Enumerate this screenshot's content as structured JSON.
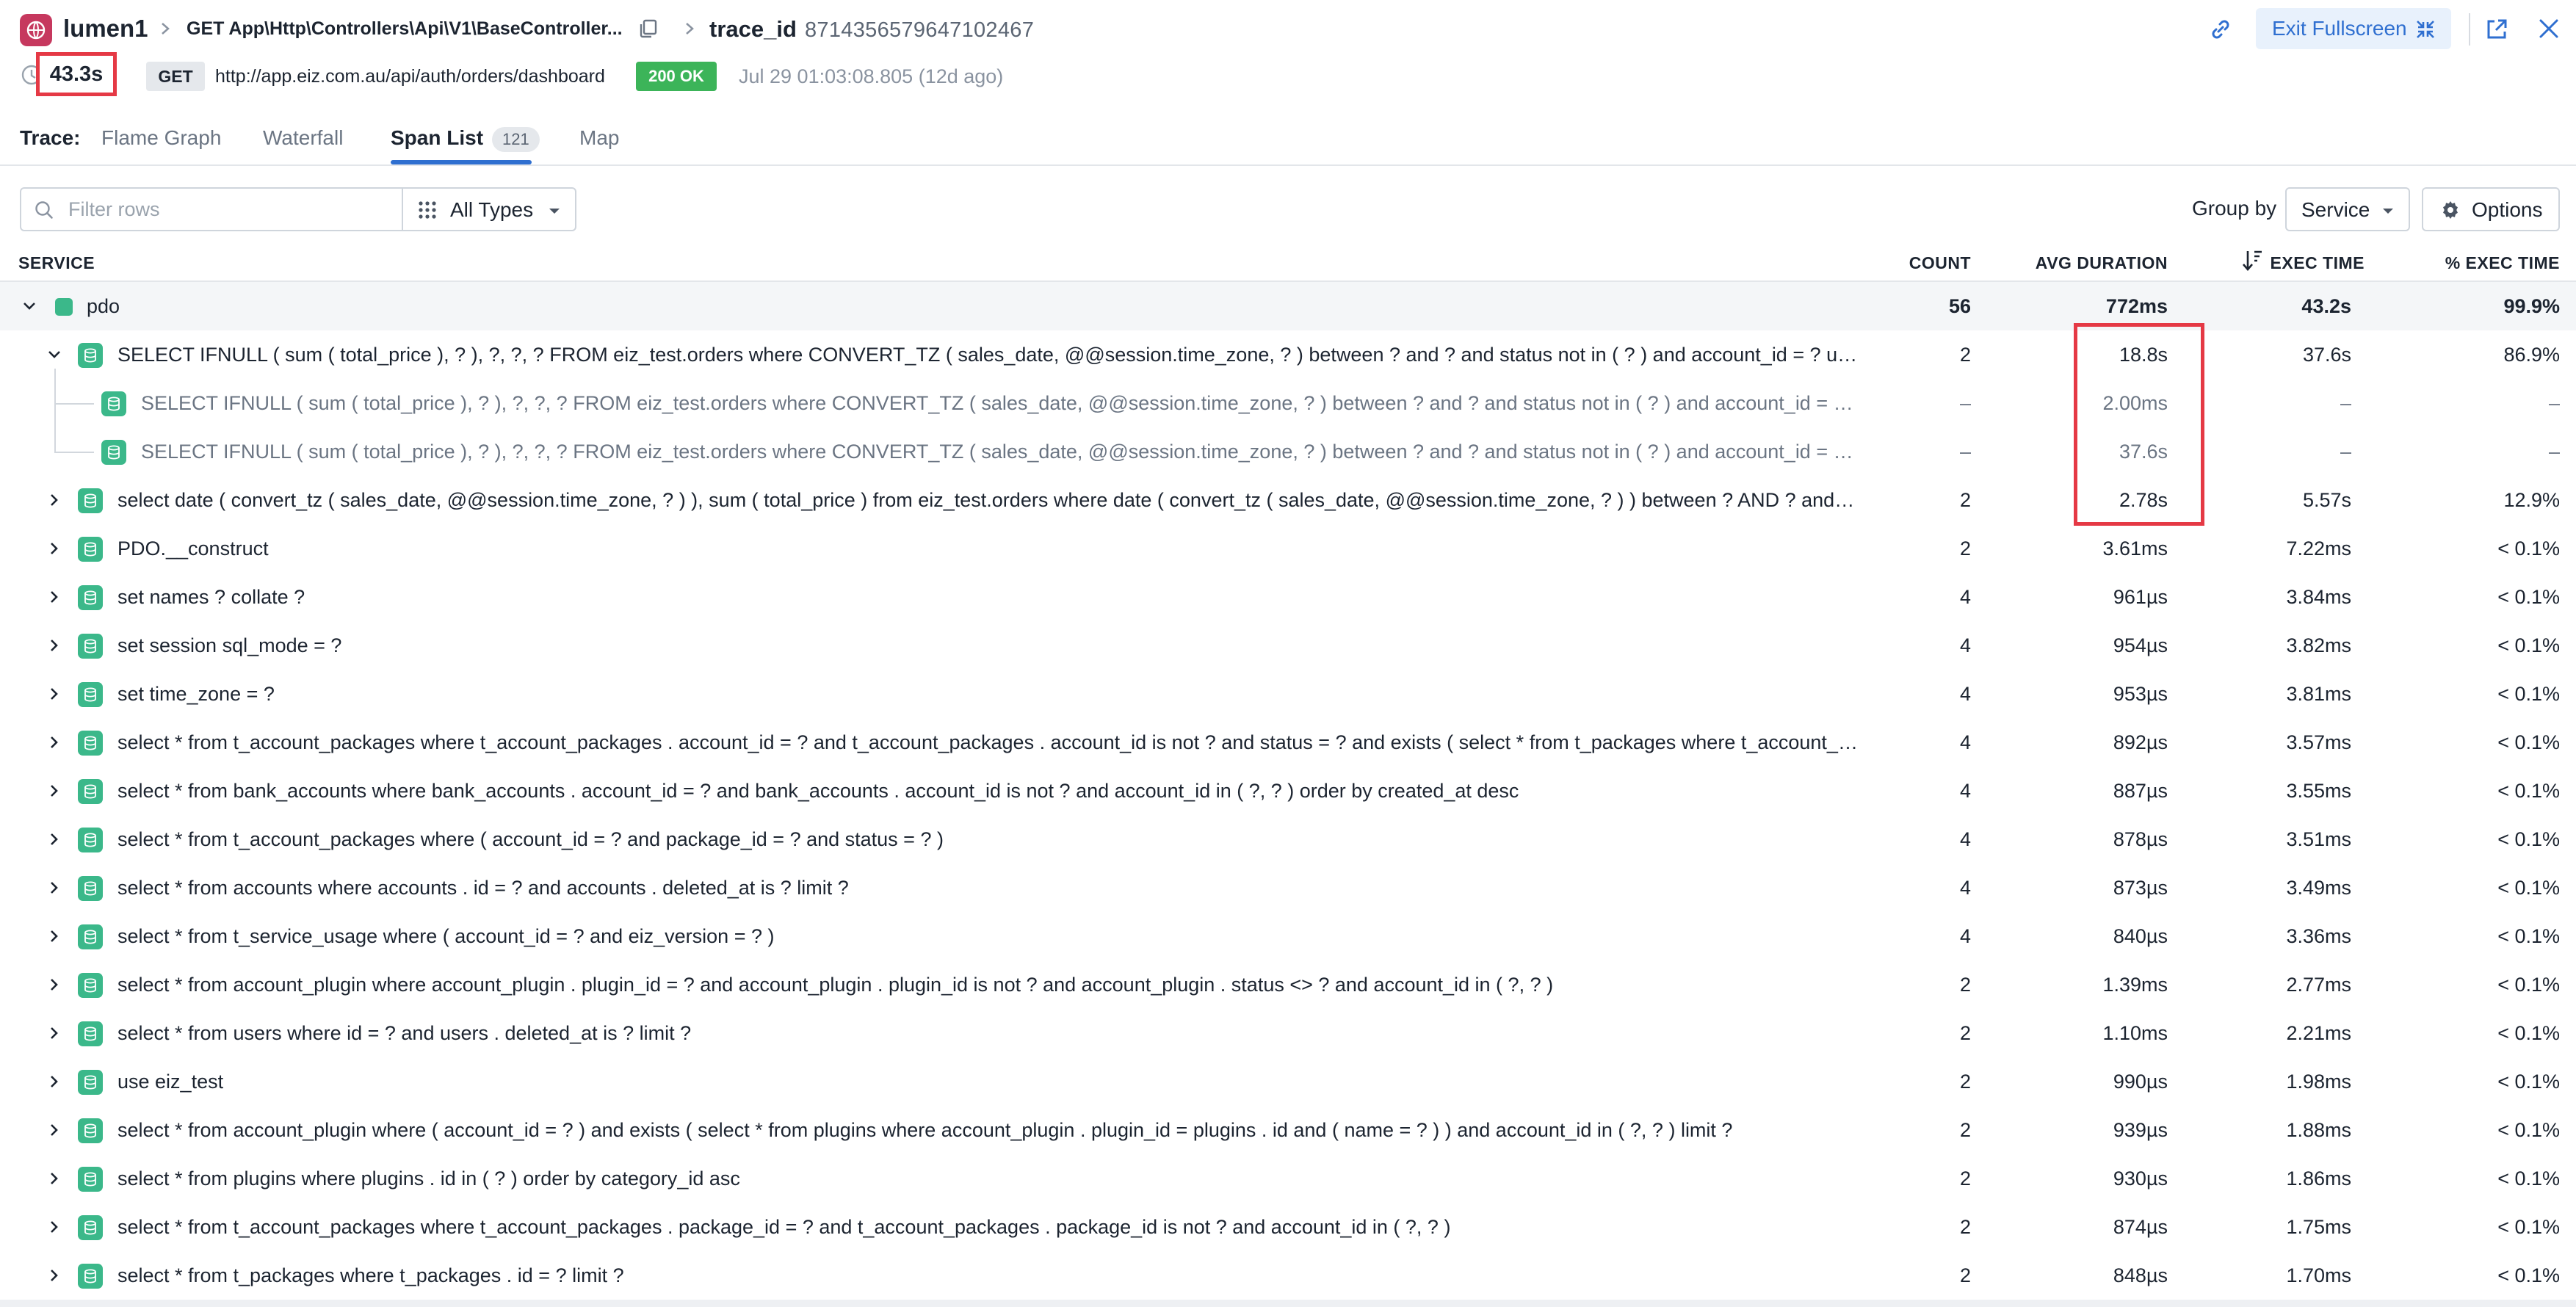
{
  "header": {
    "service": "lumen1",
    "resource": "GET App\\Http\\Controllers\\Api\\V1\\BaseController...",
    "trace_label": "trace_id",
    "trace_id": "8714356579647102467",
    "exit_fullscreen_label": "Exit Fullscreen"
  },
  "request": {
    "duration": "43.3s",
    "method": "GET",
    "url": "http://app.eiz.com.au/api/auth/orders/dashboard",
    "status": "200 OK",
    "timestamp": "Jul 29 01:03:08.805 (12d ago)"
  },
  "tabs": {
    "caption": "Trace:",
    "items": [
      {
        "label": "Flame Graph"
      },
      {
        "label": "Waterfall"
      },
      {
        "label": "Span List",
        "count": "121"
      },
      {
        "label": "Map"
      }
    ]
  },
  "toolbar": {
    "filter_placeholder": "Filter rows",
    "types_label": "All Types",
    "groupby_label": "Group by",
    "groupby_value": "Service",
    "options_label": "Options"
  },
  "table": {
    "headers": {
      "service": "SERVICE",
      "count": "COUNT",
      "avg_duration": "AVG DURATION",
      "exec_time": "EXEC TIME",
      "pct_exec_time": "% EXEC TIME"
    },
    "group": {
      "name": "pdo",
      "count": "56",
      "avg": "772ms",
      "exec": "43.2s",
      "pct": "99.9%"
    },
    "rows": [
      {
        "name": "SELECT IFNULL ( sum ( total_price ), ? ), ?, ?, ? FROM eiz_test.orders where CONVERT_TZ ( sales_date, @@session.time_zone, ? ) between ? and ? and status not in ( ? ) and account_id = ? union all S...",
        "count": "2",
        "avg": "18.8s",
        "exec": "37.6s",
        "pct": "86.9%"
      },
      {
        "name": "SELECT IFNULL ( sum ( total_price ), ? ), ?, ?, ? FROM eiz_test.orders where CONVERT_TZ ( sales_date, @@session.time_zone, ? ) between ? and ? and status not in ( ? ) and account_id = ? union al...",
        "count": "–",
        "avg": "2.00ms",
        "exec": "–",
        "pct": "–"
      },
      {
        "name": "SELECT IFNULL ( sum ( total_price ), ? ), ?, ?, ? FROM eiz_test.orders where CONVERT_TZ ( sales_date, @@session.time_zone, ? ) between ? and ? and status not in ( ? ) and account_id = ? union al...",
        "count": "–",
        "avg": "37.6s",
        "exec": "–",
        "pct": "–"
      },
      {
        "name": "select date ( convert_tz ( sales_date, @@session.time_zone, ? ) ), sum ( total_price ) from eiz_test.orders where date ( convert_tz ( sales_date, @@session.time_zone, ? ) ) between ? AND ? and acco...",
        "count": "2",
        "avg": "2.78s",
        "exec": "5.57s",
        "pct": "12.9%"
      },
      {
        "name": "PDO.__construct",
        "count": "2",
        "avg": "3.61ms",
        "exec": "7.22ms",
        "pct": "< 0.1%"
      },
      {
        "name": "set names ? collate ?",
        "count": "4",
        "avg": "961µs",
        "exec": "3.84ms",
        "pct": "< 0.1%"
      },
      {
        "name": "set session sql_mode = ?",
        "count": "4",
        "avg": "954µs",
        "exec": "3.82ms",
        "pct": "< 0.1%"
      },
      {
        "name": "set time_zone = ?",
        "count": "4",
        "avg": "953µs",
        "exec": "3.81ms",
        "pct": "< 0.1%"
      },
      {
        "name": "select * from t_account_packages where t_account_packages . account_id = ? and t_account_packages . account_id is not ? and status = ? and exists ( select * from t_packages where t_account_p...",
        "count": "4",
        "avg": "892µs",
        "exec": "3.57ms",
        "pct": "< 0.1%"
      },
      {
        "name": "select * from bank_accounts where bank_accounts . account_id = ? and bank_accounts . account_id is not ? and account_id in ( ?, ? ) order by created_at desc",
        "count": "4",
        "avg": "887µs",
        "exec": "3.55ms",
        "pct": "< 0.1%"
      },
      {
        "name": "select * from t_account_packages where ( account_id = ? and package_id = ? and status = ? )",
        "count": "4",
        "avg": "878µs",
        "exec": "3.51ms",
        "pct": "< 0.1%"
      },
      {
        "name": "select * from accounts where accounts . id = ? and accounts . deleted_at is ? limit ?",
        "count": "4",
        "avg": "873µs",
        "exec": "3.49ms",
        "pct": "< 0.1%"
      },
      {
        "name": "select * from t_service_usage where ( account_id = ? and eiz_version = ? )",
        "count": "4",
        "avg": "840µs",
        "exec": "3.36ms",
        "pct": "< 0.1%"
      },
      {
        "name": "select * from account_plugin where account_plugin . plugin_id = ? and account_plugin . plugin_id is not ? and account_plugin . status <> ? and account_id in ( ?, ? )",
        "count": "2",
        "avg": "1.39ms",
        "exec": "2.77ms",
        "pct": "< 0.1%"
      },
      {
        "name": "select * from users where id = ? and users . deleted_at is ? limit ?",
        "count": "2",
        "avg": "1.10ms",
        "exec": "2.21ms",
        "pct": "< 0.1%"
      },
      {
        "name": "use eiz_test",
        "count": "2",
        "avg": "990µs",
        "exec": "1.98ms",
        "pct": "< 0.1%"
      },
      {
        "name": "select * from account_plugin where ( account_id = ? ) and exists ( select * from plugins where account_plugin . plugin_id = plugins . id and ( name = ? ) ) and account_id in ( ?, ? ) limit ?",
        "count": "2",
        "avg": "939µs",
        "exec": "1.88ms",
        "pct": "< 0.1%"
      },
      {
        "name": "select * from plugins where plugins . id in ( ? ) order by category_id asc",
        "count": "2",
        "avg": "930µs",
        "exec": "1.86ms",
        "pct": "< 0.1%"
      },
      {
        "name": "select * from t_account_packages where t_account_packages . package_id = ? and t_account_packages . package_id is not ? and account_id in ( ?, ? )",
        "count": "2",
        "avg": "874µs",
        "exec": "1.75ms",
        "pct": "< 0.1%"
      },
      {
        "name": "select * from t_packages where t_packages . id = ? limit ?",
        "count": "2",
        "avg": "848µs",
        "exec": "1.70ms",
        "pct": "< 0.1%"
      }
    ]
  },
  "colors": {
    "accent": "#2f6fd0",
    "service_green": "#3bb88a",
    "status_ok": "#3cb459",
    "highlight": "#e53945",
    "app_logo": "#c6385e"
  }
}
